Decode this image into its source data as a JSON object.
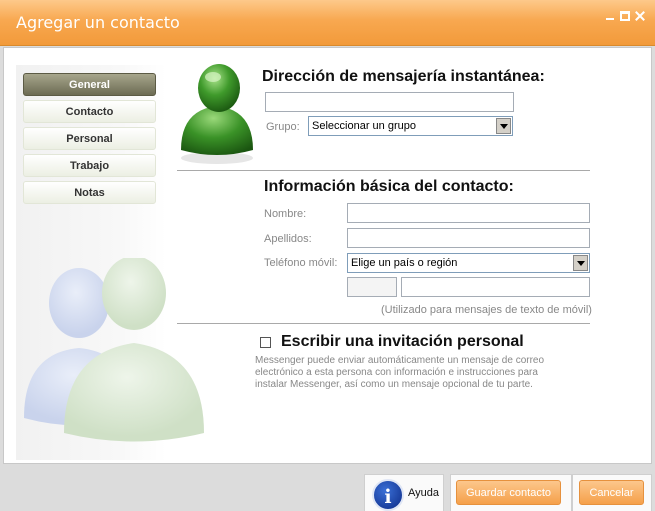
{
  "window": {
    "title": "Agregar un contacto"
  },
  "sidebar": {
    "items": [
      {
        "label": "General",
        "active": true
      },
      {
        "label": "Contacto",
        "active": false
      },
      {
        "label": "Personal",
        "active": false
      },
      {
        "label": "Trabajo",
        "active": false
      },
      {
        "label": "Notas",
        "active": false
      }
    ]
  },
  "im_section": {
    "heading": "Dirección de mensajería instantánea:",
    "address_value": "",
    "group_label": "Grupo:",
    "group_selected": "Seleccionar un grupo"
  },
  "basic_section": {
    "heading": "Información básica del contacto:",
    "first_name_label": "Nombre:",
    "first_name_value": "",
    "last_name_label": "Apellidos:",
    "last_name_value": "",
    "mobile_label": "Teléfono móvil:",
    "country_selected": "Elige un país o región",
    "area_code_value": "",
    "phone_value": "",
    "mobile_note": "(Utilizado para mensajes de texto de móvil)"
  },
  "invite_section": {
    "checked": false,
    "label": "Escribir una invitación personal",
    "description_line1": "Messenger puede enviar automáticamente un mensaje de correo",
    "description_line2": "electrónico a esta persona con información e instrucciones para",
    "description_line3": "instalar Messenger, así como un mensaje opcional de tu parte."
  },
  "footer": {
    "help_label": "Ayuda",
    "save_label": "Guardar contacto",
    "cancel_label": "Cancelar"
  },
  "colors": {
    "titlebar": "#f8a850",
    "button_orange": "#f5a04a",
    "active_nav": "#6c6b53",
    "buddy_green": "#3f9a2b"
  },
  "icons": [
    "minimize-icon",
    "maximize-icon",
    "close-icon",
    "contact-avatar-icon",
    "help-icon",
    "checkbox-icon",
    "dropdown-arrow-icon"
  ]
}
